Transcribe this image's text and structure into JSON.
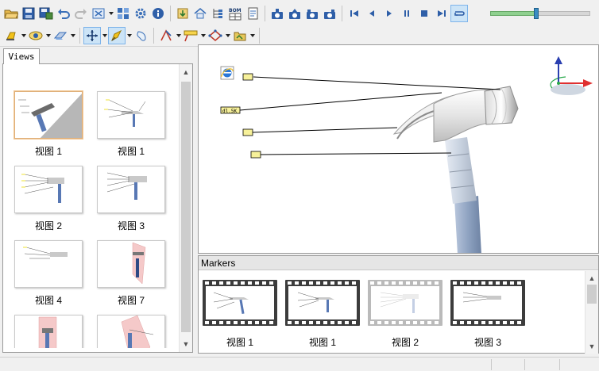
{
  "toolbar1": {
    "buttons": [
      "open-icon",
      "save-icon",
      "save-as-icon",
      "undo-icon",
      "redo-icon",
      "fit-view-icon",
      "explode-icon",
      "settings-icon",
      "info-icon",
      "import-icon",
      "home-view-icon",
      "tree-icon",
      "bom-icon",
      "notes-icon",
      "camera-1-icon",
      "camera-2-icon",
      "camera-3-icon",
      "camera-4-icon",
      "first-frame-icon",
      "prev-frame-icon",
      "play-icon",
      "pause-icon",
      "stop-icon",
      "last-frame-icon",
      "loop-icon"
    ],
    "bom_text": "BOM",
    "slider_position": 0.46
  },
  "toolbar2": {
    "buttons": [
      "highlight-icon",
      "visibility-icon",
      "eraser-icon",
      "move-icon",
      "paint-icon",
      "shape-icon",
      "line-annotation-icon",
      "callout-icon",
      "polygon-icon",
      "markup-icon"
    ]
  },
  "views": {
    "tab_label": "Views",
    "items": [
      {
        "label": "视图 1",
        "selected": true
      },
      {
        "label": "视图 1",
        "selected": false
      },
      {
        "label": "视图 2",
        "selected": false
      },
      {
        "label": "视图 3",
        "selected": false
      },
      {
        "label": "视图 4",
        "selected": false
      },
      {
        "label": "视图 7",
        "selected": false
      },
      {
        "label": "",
        "selected": false
      },
      {
        "label": "",
        "selected": false
      }
    ]
  },
  "viewport": {
    "callouts": [
      "",
      "",
      "",
      ""
    ],
    "callout_long": "dl.5K"
  },
  "markers": {
    "header": "Markers",
    "items": [
      {
        "label": "视图 1",
        "faded": false
      },
      {
        "label": "视图 1",
        "faded": false
      },
      {
        "label": "视图 2",
        "faded": true
      },
      {
        "label": "视图 3",
        "faded": false
      }
    ]
  },
  "colors": {
    "accent_blue": "#3a8cc2",
    "slider_fill": "#8fd08f",
    "callout_yellow": "#f7f19a",
    "axis_red": "#e03030",
    "axis_green": "#27a84a",
    "axis_blue": "#2a3fb0"
  }
}
